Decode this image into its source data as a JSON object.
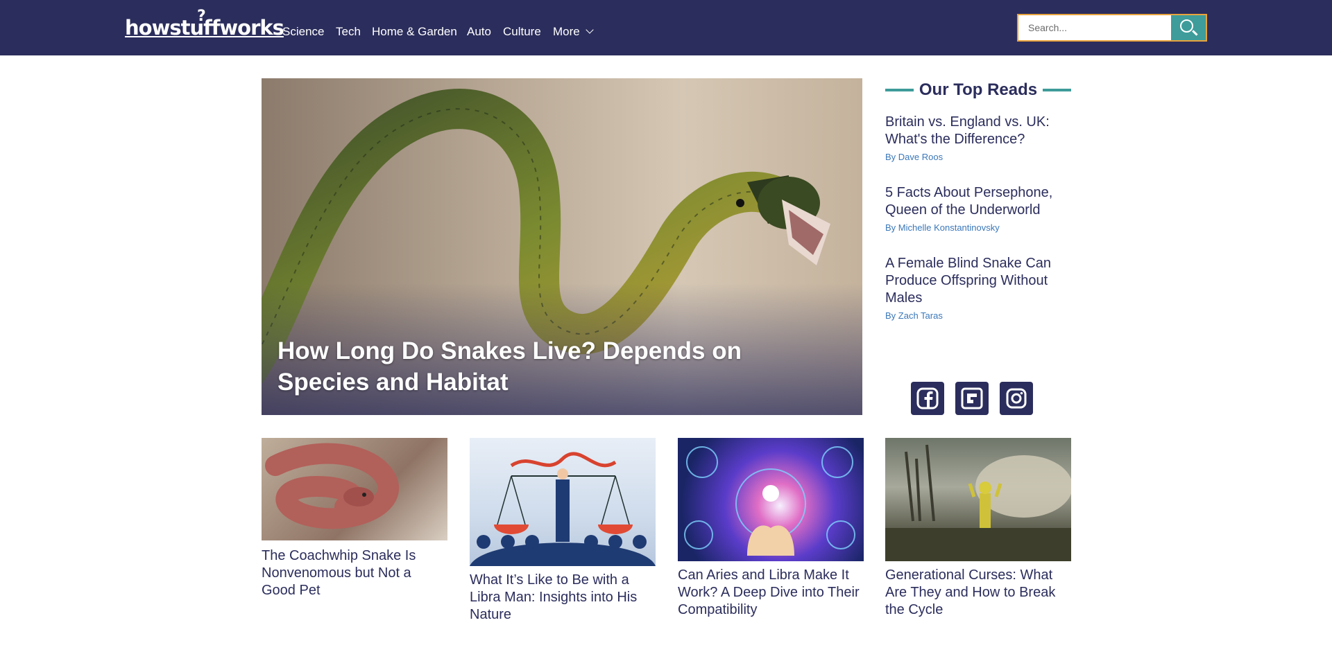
{
  "header": {
    "logo_text": "howstuffworks",
    "nav": [
      {
        "label": "Science"
      },
      {
        "label": "Tech"
      },
      {
        "label": "Home & Garden"
      },
      {
        "label": "Auto"
      },
      {
        "label": "Culture"
      },
      {
        "label": "More"
      }
    ],
    "search": {
      "placeholder": "Search..."
    }
  },
  "hero": {
    "title": "How Long Do Snakes Live? Depends on Species and Habitat"
  },
  "top_reads": {
    "heading": "Our Top Reads",
    "items": [
      {
        "title": "Britain vs. England vs. UK: What's the Difference?",
        "byline": "By Dave Roos"
      },
      {
        "title": "5 Facts About Persephone, Queen of the Underworld",
        "byline": "By Michelle Konstantinovsky"
      },
      {
        "title": "A Female Blind Snake Can Produce Offspring Without Males",
        "byline": "By Zach Taras"
      }
    ]
  },
  "social": [
    "facebook-icon",
    "flipboard-icon",
    "instagram-icon"
  ],
  "cards": [
    {
      "title": "The Coachwhip Snake Is Nonvenomous but Not a Good Pet"
    },
    {
      "title": "What It’s Like to Be with a Libra Man: Insights into His Nature"
    },
    {
      "title": "Can Aries and Libra Make It Work? A Deep Dive into Their Compatibility"
    },
    {
      "title": "Generational Curses: What Are They and How to Break the Cycle"
    }
  ],
  "colors": {
    "header_bg": "#2b2d5c",
    "accent_teal": "#3e9c9a",
    "search_border": "#e8a33c",
    "byline_link": "#3a77b9"
  }
}
